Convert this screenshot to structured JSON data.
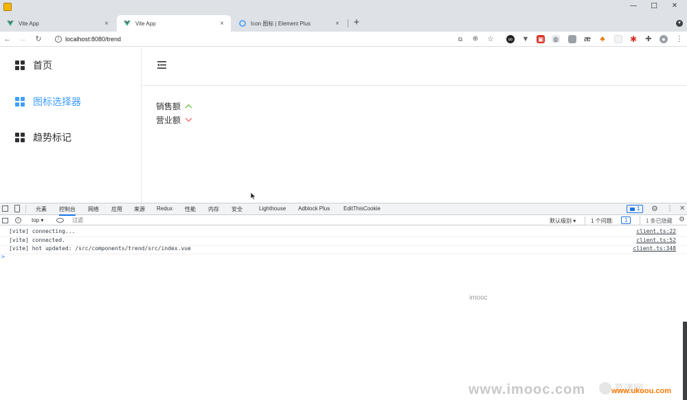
{
  "browser": {
    "tabs": [
      {
        "title": "Vite App",
        "active": false
      },
      {
        "title": "Vite App",
        "active": true
      },
      {
        "title": "Icon 图标 | Element Plus",
        "active": false
      }
    ],
    "new_tab_label": "+",
    "close_glyph": "×",
    "url": "localhost:8080/trend",
    "window_controls": {
      "minimize": "—",
      "maximize": "☐",
      "close": "✕"
    }
  },
  "sidebar": {
    "items": [
      {
        "label": "首页",
        "active": false
      },
      {
        "label": "图标选择器",
        "active": true
      },
      {
        "label": "趋势标记",
        "active": false
      }
    ]
  },
  "trends": [
    {
      "label": "销售额",
      "direction": "up",
      "color": "#67c23a"
    },
    {
      "label": "营业额",
      "direction": "down",
      "color": "#f56c6c"
    }
  ],
  "devtools": {
    "tabs": [
      "元素",
      "控制台",
      "网络",
      "应用",
      "来源",
      "Redux",
      "性能",
      "内存",
      "安全",
      "Lighthouse",
      "Adblock Plus",
      "EditThisCookie"
    ],
    "active_tab": "控制台",
    "issue_badge": "1",
    "context": "top ▾",
    "filter_placeholder": "过滤",
    "level": "默认级别 ▾",
    "issues_label": "1 个问题:",
    "issues_count": "1",
    "hidden_label": "1 条已隐藏",
    "console": [
      {
        "text": "[vite] connecting...",
        "source": "client.ts:22"
      },
      {
        "text": "[vite] connected.",
        "source": "client.ts:52"
      },
      {
        "text": "[vite] hot updated: /src/components/trend/src/index.vue",
        "source": "client.ts:348"
      }
    ],
    "prompt": ">"
  },
  "watermarks": {
    "center": "imooc",
    "site": "www.imooc.com",
    "badge_text": "慕课网",
    "corner": "www.ukoou.com"
  },
  "colors": {
    "accent": "#409eff",
    "up": "#67c23a",
    "down": "#f56c6c"
  }
}
